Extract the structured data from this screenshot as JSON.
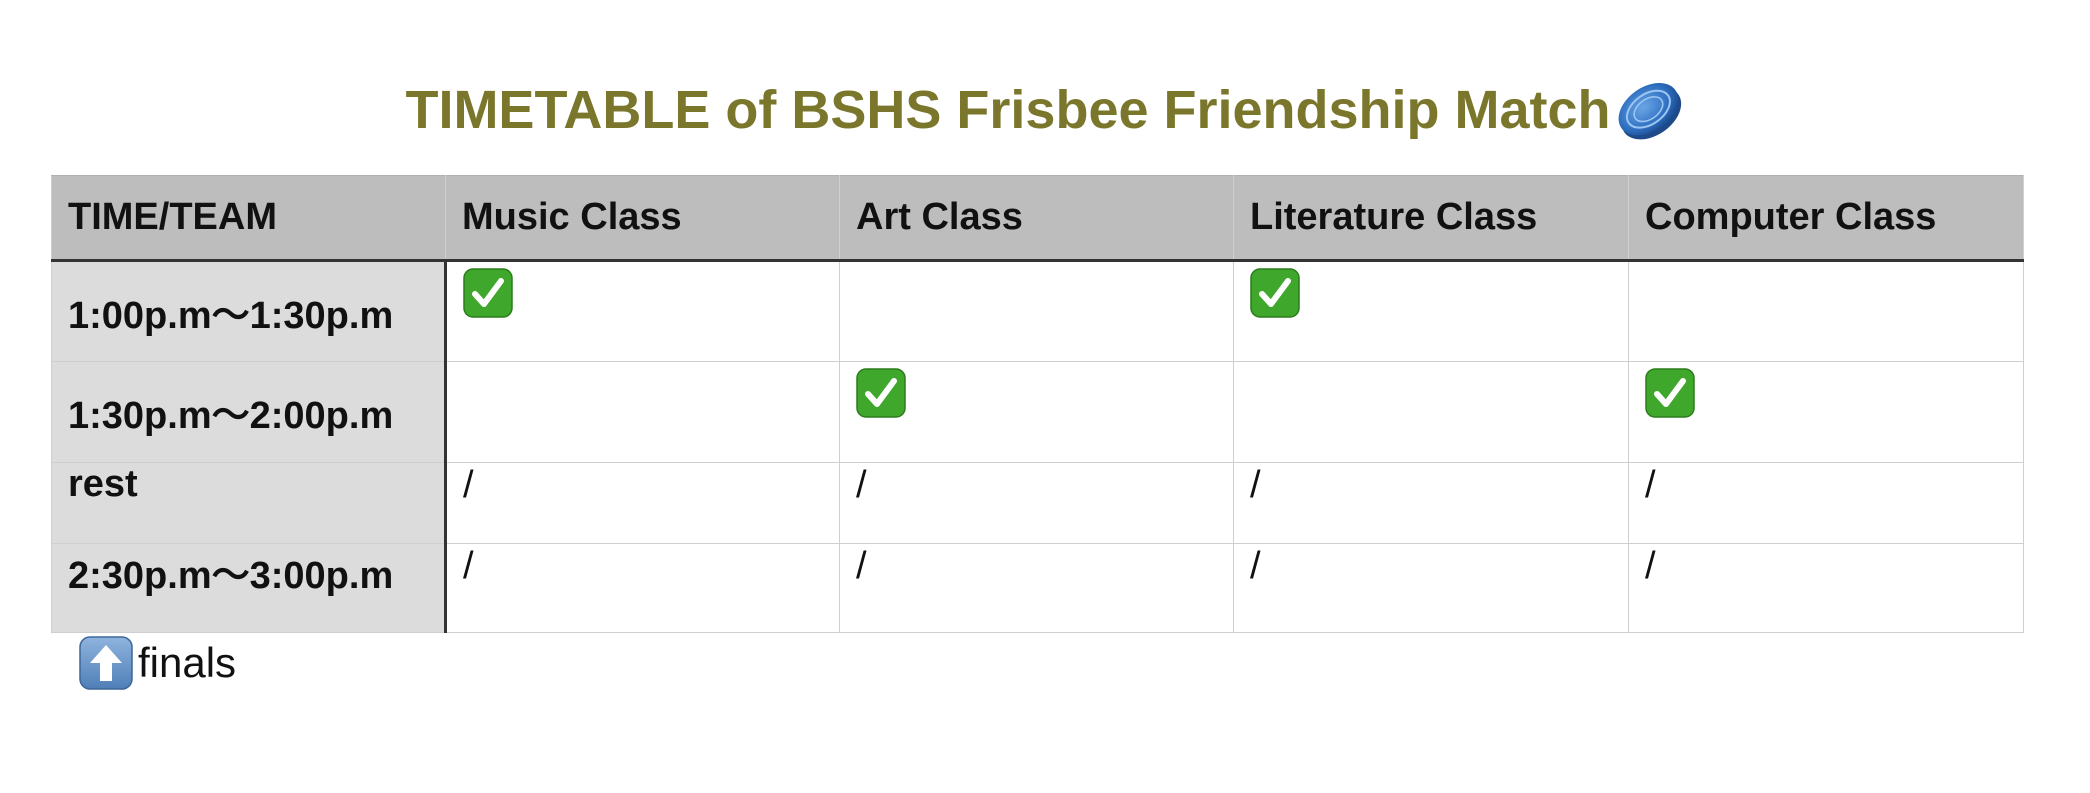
{
  "title": "TIMETABLE of BSHS Frisbee Friendship Match",
  "title_icon": "frisbee-icon",
  "colors": {
    "title": "#7a772c",
    "header_bg": "#bdbdbd",
    "time_col_bg": "#dcdcdc",
    "check_green": "#3fa72b"
  },
  "table": {
    "columns": [
      "TIME/TEAM",
      "Music Class",
      "Art Class",
      "Literature Class",
      "Computer Class"
    ],
    "rows": [
      {
        "time": "1:00p.m～1:30p.m",
        "cells": [
          "check",
          "",
          "check",
          ""
        ]
      },
      {
        "time": "1:30p.m～2:00p.m",
        "cells": [
          "",
          "check",
          "",
          "check"
        ]
      },
      {
        "time": "rest",
        "cells": [
          "/",
          "/",
          "/",
          "/"
        ]
      },
      {
        "time": "2:30p.m～3:00p.m",
        "cells": [
          "/",
          "/",
          "/",
          "/"
        ]
      }
    ]
  },
  "note": {
    "icon": "up-arrow-icon",
    "text": "finals"
  }
}
